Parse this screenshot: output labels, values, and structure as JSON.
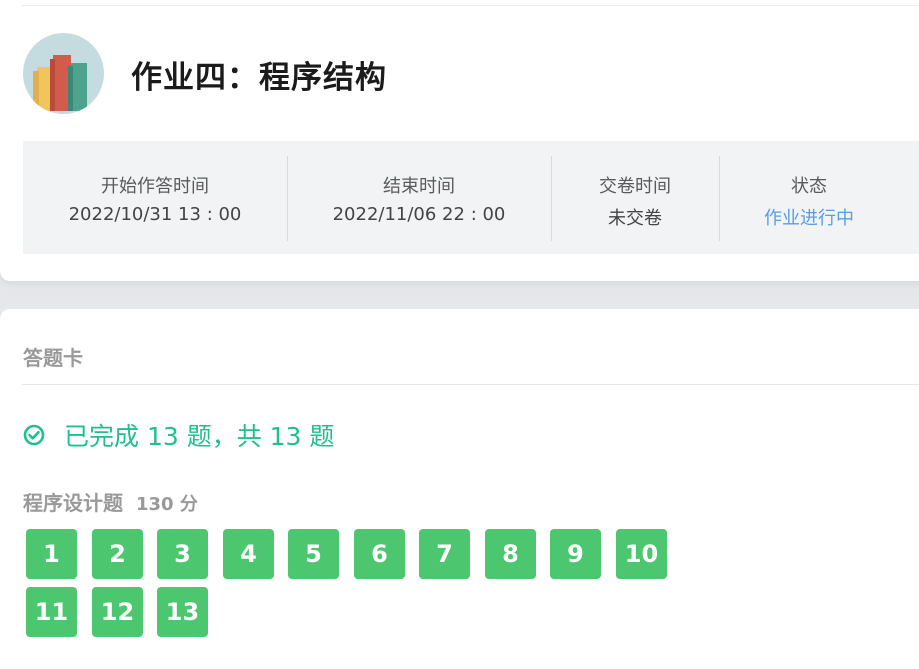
{
  "assignment": {
    "title": "作业四：程序结构"
  },
  "info": [
    {
      "label": "开始作答时间",
      "value": "2022/10/31 13 : 00"
    },
    {
      "label": "结束时间",
      "value": "2022/11/06 22 : 00"
    },
    {
      "label": "交卷时间",
      "value": "未交卷"
    },
    {
      "label": "状态",
      "value": "作业进行中"
    }
  ],
  "answer_card": {
    "title": "答题卡",
    "progress_text": "已完成 13 题，共 13 题",
    "completed": 13,
    "total": 13,
    "section": {
      "name": "程序设计题",
      "score": "130 分",
      "questions": [
        "1",
        "2",
        "3",
        "4",
        "5",
        "6",
        "7",
        "8",
        "9",
        "10",
        "11",
        "12",
        "13"
      ]
    }
  },
  "colors": {
    "accent_green": "#1fbf8f",
    "question_green": "#4cc76f",
    "status_blue": "#5b9be6"
  }
}
